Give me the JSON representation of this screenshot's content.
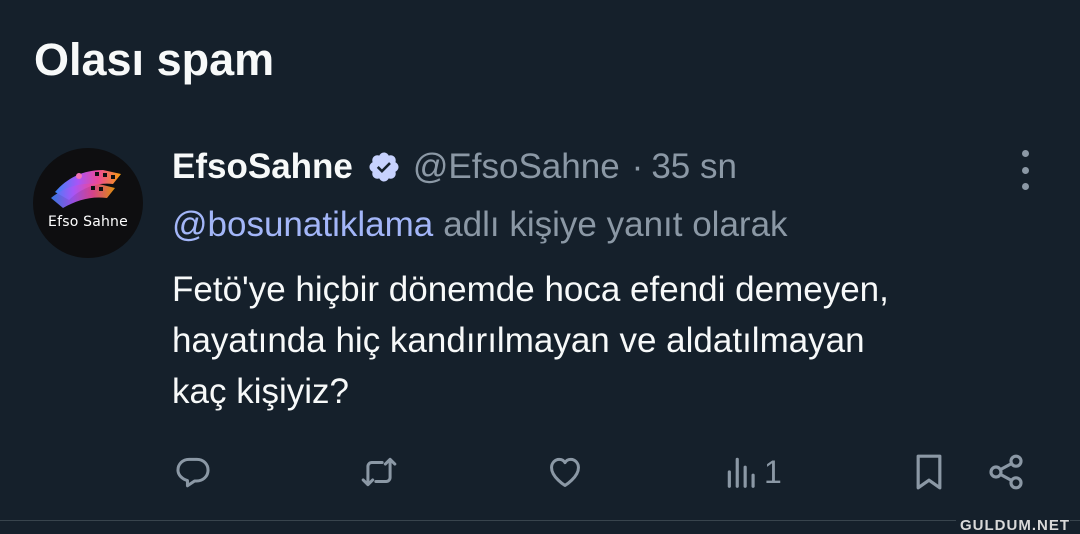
{
  "section_title": "Olası spam",
  "colors": {
    "background": "#15202b",
    "text": "#f7f9f9",
    "muted": "#8b98a5",
    "mention": "#a3b6f8",
    "verified_badge": "#c7d2fe"
  },
  "tweet": {
    "avatar": {
      "text": "Efso Sahne",
      "icon": "film-strip-logo"
    },
    "display_name": "EfsoSahne",
    "verified_icon": "verified-badge-icon",
    "handle": "@EfsoSahne",
    "separator": "·",
    "time": "35 sn",
    "more_icon": "more-options-icon",
    "reply_to": {
      "mention": "@bosunatiklama",
      "suffix": "adlı kişiye yanıt olarak"
    },
    "text_lines": [
      "Fetö'ye hiçbir dönemde hoca efendi demeyen,",
      "hayatında hiç kandırılmayan ve aldatılmayan",
      "kaç kişiyiz?"
    ],
    "actions": {
      "reply_icon": "reply-icon",
      "retweet_icon": "retweet-icon",
      "like_icon": "like-icon",
      "views_icon": "views-icon",
      "views_count": "1",
      "bookmark_icon": "bookmark-icon",
      "share_icon": "share-icon"
    }
  },
  "watermark": "GULDUM.NET"
}
